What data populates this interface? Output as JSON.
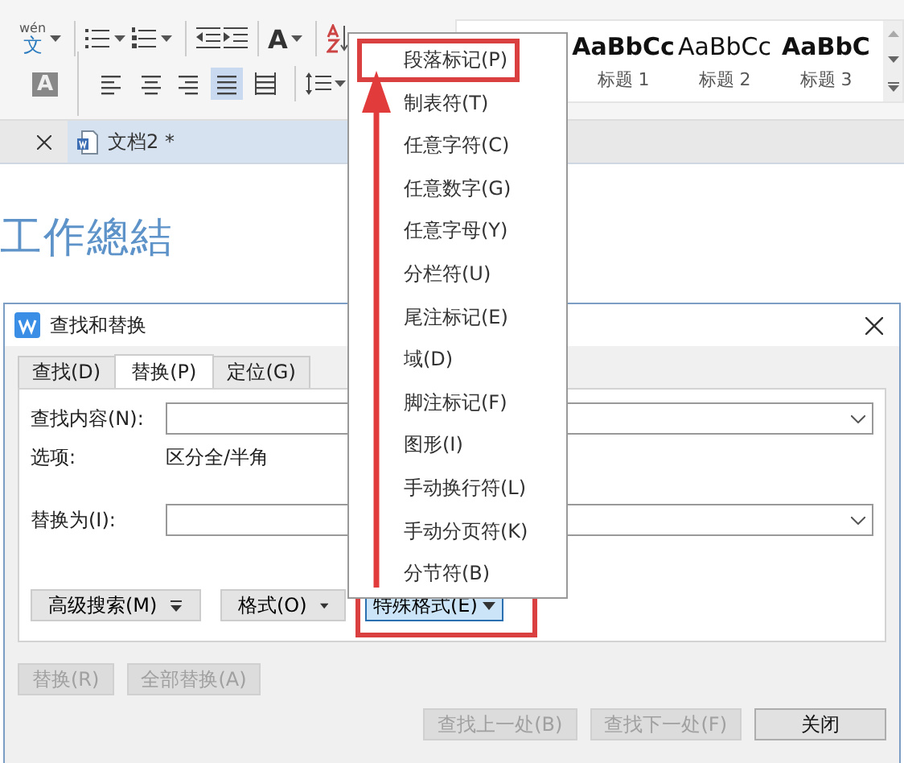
{
  "ribbon": {
    "phonetic_guide": {
      "ruby": "wén",
      "base": "文"
    },
    "grow_font_label": "A",
    "shading_label": "A",
    "alignment": [
      {
        "kind": "left",
        "selected": false
      },
      {
        "kind": "center",
        "selected": false
      },
      {
        "kind": "right",
        "selected": false
      },
      {
        "kind": "justify",
        "selected": true
      },
      {
        "kind": "distribute",
        "selected": false
      }
    ],
    "styles": [
      {
        "sample": "AaBbCc",
        "label": "标题 1",
        "bold": true
      },
      {
        "sample": "AaBbCc",
        "label": "标题 2",
        "bold": false
      },
      {
        "sample": "AaBbC",
        "label": "标题 3",
        "bold": true
      }
    ]
  },
  "document_tabs": [
    {
      "title": "文档2 *",
      "selected": true
    }
  ],
  "document": {
    "heading": "工作總結"
  },
  "dialog": {
    "title": "查找和替换",
    "tabs": [
      {
        "label": "查找(D)",
        "selected": false
      },
      {
        "label": "替换(P)",
        "selected": true
      },
      {
        "label": "定位(G)",
        "selected": false
      }
    ],
    "find_label": "查找内容(N):",
    "options_label": "选项:",
    "options_value": "区分全/半角",
    "replace_label": "替换为(I):",
    "menu_buttons": [
      {
        "label": "高级搜索(M)",
        "kind": "double",
        "active": false,
        "marked": false
      },
      {
        "label": "格式(O)",
        "kind": "single",
        "active": false,
        "marked": false
      },
      {
        "label": "特殊格式(E)",
        "kind": "single",
        "active": true,
        "marked": true
      }
    ],
    "replace_buttons": [
      {
        "label": "替换(R)",
        "disabled": true
      },
      {
        "label": "全部替换(A)",
        "disabled": true
      }
    ],
    "nav_buttons": [
      {
        "label": "查找上一处(B)",
        "disabled": true
      },
      {
        "label": "查找下一处(F)",
        "disabled": true
      },
      {
        "label": "关闭",
        "disabled": false
      }
    ]
  },
  "special_menu": {
    "items": [
      {
        "label": "段落标记(P)",
        "marked": true
      },
      {
        "label": "制表符(T)",
        "marked": false
      },
      {
        "label": "任意字符(C)",
        "marked": false
      },
      {
        "label": "任意数字(G)",
        "marked": false
      },
      {
        "label": "任意字母(Y)",
        "marked": false
      },
      {
        "label": "分栏符(U)",
        "marked": false
      },
      {
        "label": "尾注标记(E)",
        "marked": false
      },
      {
        "label": "域(D)",
        "marked": false
      },
      {
        "label": "脚注标记(F)",
        "marked": false
      },
      {
        "label": "图形(I)",
        "marked": false
      },
      {
        "label": "手动换行符(L)",
        "marked": false
      },
      {
        "label": "手动分页符(K)",
        "marked": false
      },
      {
        "label": "分节符(B)",
        "marked": false
      }
    ]
  }
}
